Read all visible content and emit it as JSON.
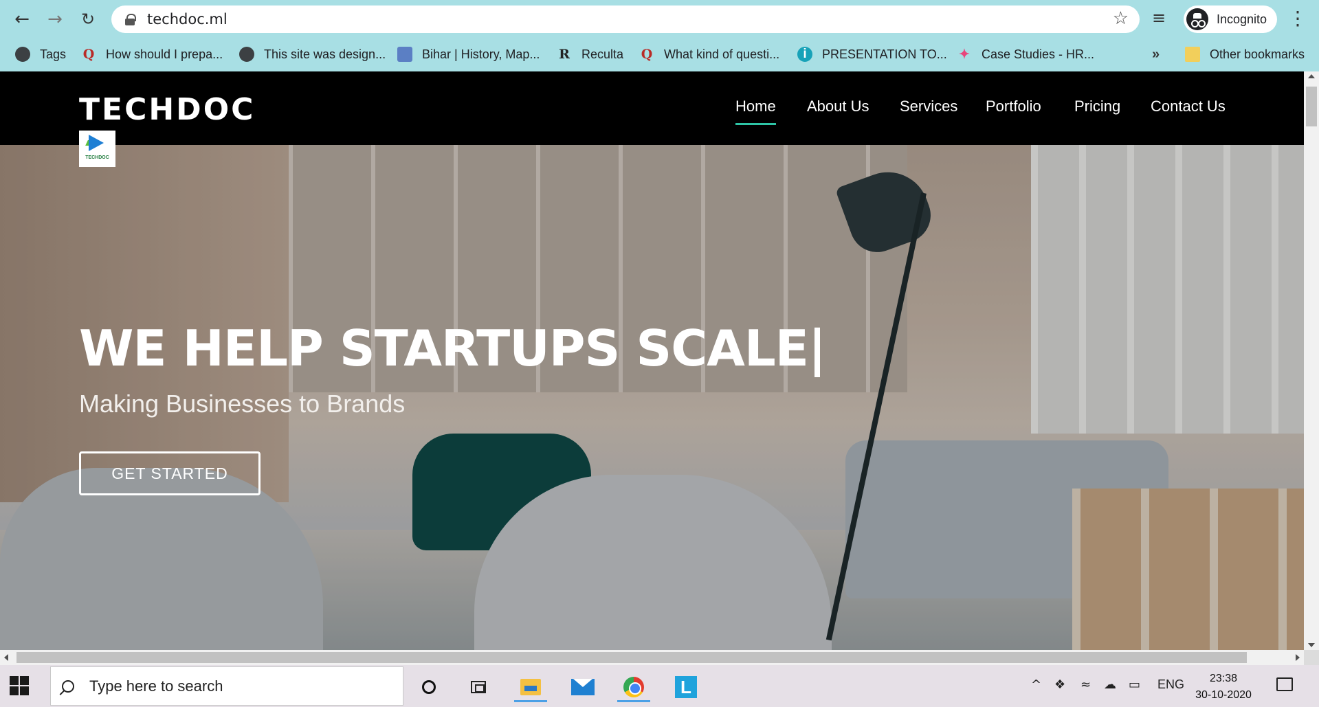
{
  "browser": {
    "url": "techdoc.ml",
    "profile_label": "Incognito",
    "icons": [
      "back-arrow-icon",
      "forward-arrow-icon",
      "reload-icon",
      "lock-icon",
      "star-icon",
      "tab-search-icon",
      "incognito-icon",
      "menu-dots-icon"
    ],
    "bookmarks": [
      {
        "label": "Tags",
        "icon": "globe-icon"
      },
      {
        "label": "How should I prepa...",
        "icon": "quora-icon"
      },
      {
        "label": "This site was design...",
        "icon": "globe-icon"
      },
      {
        "label": "Bihar | History, Map...",
        "icon": "emblem-icon"
      },
      {
        "label": "Reculta",
        "icon": "reculta-icon"
      },
      {
        "label": "What kind of questi...",
        "icon": "quora-icon"
      },
      {
        "label": "PRESENTATION TO...",
        "icon": "presentation-icon"
      },
      {
        "label": "Case Studies - HR...",
        "icon": "case-studies-icon"
      }
    ],
    "overflow_label": "»",
    "other_bookmarks": "Other bookmarks"
  },
  "site": {
    "brand": "TECHDOC",
    "logo_text": "TECHDOC",
    "nav": [
      {
        "label": "Home",
        "active": true
      },
      {
        "label": "About Us",
        "active": false
      },
      {
        "label": "Services",
        "active": false
      },
      {
        "label": "Portfolio",
        "active": false
      },
      {
        "label": "Pricing",
        "active": false
      },
      {
        "label": "Contact Us",
        "active": false
      }
    ],
    "hero": {
      "title": "WE HELP STARTUPS SCALE|",
      "subtitle": "Making Businesses to Brands",
      "cta": "GET STARTED"
    },
    "colors": {
      "header_bg": "#000000",
      "accent": "#2ec4a6",
      "chrome": "#a8dfe4"
    }
  },
  "taskbar": {
    "search_placeholder": "Type here to search",
    "language": "ENG",
    "time": "23:38",
    "date": "30-10-2020",
    "tray_caret": "^"
  }
}
